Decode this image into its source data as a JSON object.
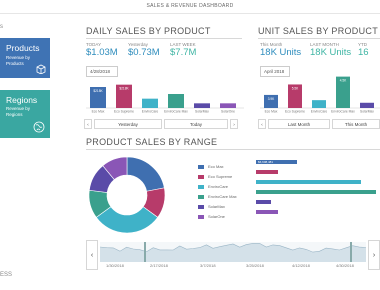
{
  "app": {
    "title": "SALES & REVENUE DASHBOARD"
  },
  "left": {
    "top_text": "s",
    "bottom_text": "ESS",
    "tiles": [
      {
        "title": "Products",
        "subtitle": "Revenue by Products",
        "color": "#3f73b4"
      },
      {
        "title": "Regions",
        "subtitle": "Revenue by Regions",
        "color": "#3aa7a1"
      }
    ]
  },
  "daily": {
    "title": "DAILY SALES BY PRODUCT",
    "kpis": [
      {
        "label": "TODAY",
        "value": "$1.03M"
      },
      {
        "label": "Yesterday",
        "value": "$0.73M"
      },
      {
        "label": "LAST WEEK",
        "value": "$7.7M"
      }
    ],
    "date": "4/28/2018",
    "nav": {
      "prev_label": "Yesterday",
      "next_label": "Today"
    }
  },
  "unit": {
    "title": "UNIT SALES BY PRODUCT",
    "kpis": [
      {
        "label": "This Month",
        "value": "18K Units"
      },
      {
        "label": "LAST MONTH",
        "value": "18K Units"
      },
      {
        "label": "YTD",
        "value": "16"
      }
    ],
    "date": "April 2018",
    "nav": {
      "prev_label": "Last Month",
      "next_label": "This Month"
    }
  },
  "range": {
    "title": "PRODUCT SALES BY RANGE",
    "legend": [
      {
        "name": "Eco Max",
        "color": "#3f6fb0"
      },
      {
        "name": "Eco Supreme",
        "color": "#b73b6a"
      },
      {
        "name": "EnviroCare",
        "color": "#3fb2c8"
      },
      {
        "name": "EnviroCare Max",
        "color": "#3aa08d"
      },
      {
        "name": "SolarMax",
        "color": "#5a4ba8"
      },
      {
        "name": "SolarOne",
        "color": "#8a56b6"
      }
    ],
    "timeline_labels": [
      "1/30/2018",
      "2/17/2018",
      "3/7/2018",
      "3/25/2018",
      "4/12/2018",
      "4/30/2018"
    ]
  },
  "chart_data": [
    {
      "type": "bar",
      "categories": [
        "Eco Max",
        "Eco Supreme",
        "EnviroCare",
        "EnviroCare Max",
        "SolarMax",
        "SolarOne"
      ],
      "series": [
        {
          "values": [
            9,
            10,
            4,
            6,
            2,
            2
          ]
        }
      ],
      "value_labels": [
        "$218K",
        "$218K",
        "",
        "",
        "",
        ""
      ],
      "colors": [
        "#3f6fb0",
        "#b73b6a",
        "#3fb2c8",
        "#3aa08d",
        "#5a4ba8",
        "#8a56b6"
      ],
      "ylim": [
        0,
        12
      ]
    },
    {
      "type": "bar",
      "categories": [
        "Eco Max",
        "Eco Supreme",
        "EnviroCare",
        "EnviroCare Max",
        "SolarMax"
      ],
      "series": [
        {
          "values": [
            5,
            9,
            3,
            12,
            2
          ]
        }
      ],
      "value_labels": [
        "3.9K",
        "5.5K",
        "",
        "4.5K",
        ""
      ],
      "colors": [
        "#3f6fb0",
        "#b73b6a",
        "#3fb2c8",
        "#3aa08d",
        "#5a4ba8"
      ],
      "ylim": [
        0,
        13
      ]
    },
    {
      "type": "pie",
      "categories": [
        "Eco Max",
        "Eco Supreme",
        "EnviroCare",
        "EnviroCare Max",
        "SolarMax",
        "SolarOne"
      ],
      "values": [
        22,
        13,
        30,
        12,
        12,
        11
      ],
      "colors": [
        "#3f6fb0",
        "#b73b6a",
        "#3fb2c8",
        "#3aa08d",
        "#5a4ba8",
        "#8a56b6"
      ]
    },
    {
      "type": "bar",
      "categories": [
        "Eco Max",
        "Eco Supreme",
        "EnviroCare",
        "EnviroCare Max",
        "SolarMax",
        "SolarOne"
      ],
      "series": [
        {
          "values": [
            19,
            10,
            48,
            55,
            7,
            10
          ]
        }
      ],
      "value_labels": [
        "$6,608,481",
        "",
        "",
        "",
        "",
        ""
      ],
      "colors": [
        "#3f6fb0",
        "#b73b6a",
        "#3fb2c8",
        "#3aa08d",
        "#5a4ba8",
        "#8a56b6"
      ],
      "ylim": [
        0,
        55
      ]
    },
    {
      "type": "area",
      "x": [
        "1/30/2018",
        "2/17/2018",
        "3/7/2018",
        "3/25/2018",
        "4/12/2018",
        "4/30/2018"
      ],
      "series": [
        {
          "values": [
            0.7,
            0.6,
            0.75,
            0.9,
            0.55,
            0.8
          ]
        }
      ],
      "ylim": [
        0,
        1
      ]
    }
  ]
}
